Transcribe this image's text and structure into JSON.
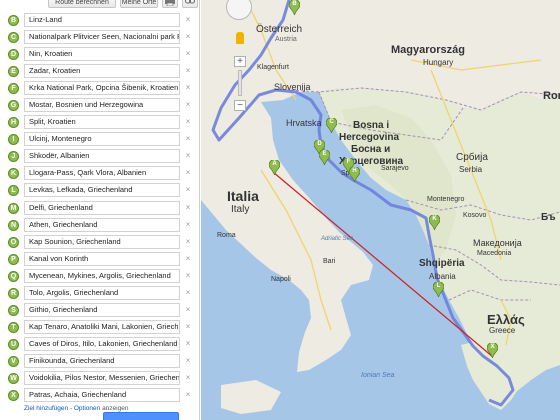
{
  "toolbar": {
    "route_button": "Route berechnen",
    "my_places_button": "Meine Orte"
  },
  "stops": [
    {
      "letter": "B",
      "value": "Linz-Land"
    },
    {
      "letter": "C",
      "value": "Nationalpark Plitvicer Seen, Nacionalni park P"
    },
    {
      "letter": "D",
      "value": "Nin, Kroatien"
    },
    {
      "letter": "E",
      "value": "Zadar, Kroatien"
    },
    {
      "letter": "F",
      "value": "Krka National Park, Opcina Šibenik, Kroatien"
    },
    {
      "letter": "G",
      "value": "Mostar, Bosnien und Herzegowina"
    },
    {
      "letter": "H",
      "value": "Split, Kroatien"
    },
    {
      "letter": "I",
      "value": "Ulcinj, Montenegro"
    },
    {
      "letter": "J",
      "value": "Shkodër, Albanien"
    },
    {
      "letter": "K",
      "value": "Llogara-Pass, Qark Vlora, Albanien"
    },
    {
      "letter": "L",
      "value": "Levkas, Lefkada, Griechenland"
    },
    {
      "letter": "M",
      "value": "Delfi, Griechenland"
    },
    {
      "letter": "N",
      "value": "Athen, Griechenland"
    },
    {
      "letter": "O",
      "value": "Kap Sounion, Griechenland"
    },
    {
      "letter": "P",
      "value": "Kanal von Korinth"
    },
    {
      "letter": "Q",
      "value": "Mycenean, Mykines, Argolis, Griechenland"
    },
    {
      "letter": "R",
      "value": "Tolo, Argolis, Griechenland"
    },
    {
      "letter": "S",
      "value": "Githio, Griechenland"
    },
    {
      "letter": "T",
      "value": "Kap Tenaro, Anatoliki Mani, Lakonien, Griech"
    },
    {
      "letter": "U",
      "value": "Caves of Diros, Itilo, Lakonien, Griechenland"
    },
    {
      "letter": "V",
      "value": "Finikounda, Griechenland"
    },
    {
      "letter": "W",
      "value": "Voidokilia, Pilos Nestor, Messenien, Griechen"
    },
    {
      "letter": "X",
      "value": "Patras, Achaia, Griechenland"
    }
  ],
  "footer": {
    "add_destination": "Ziel hinzufügen",
    "separator": " - ",
    "options": "Optionen",
    "show": " anzeigen"
  },
  "map": {
    "labels": {
      "austria_de": "Österreich",
      "austria_en": "Austria",
      "hungary_de": "Magyarország",
      "hungary_en": "Hungary",
      "romania": "Rom",
      "slovenia": "Slovenija",
      "croatia": "Hrvatska",
      "bosnia_latin": "Bosna i",
      "herzegovina_latin": "Hercegovina",
      "bosnia_cyr": "Босна и",
      "herzegovina_cyr": "Херцеговина",
      "serbia_cyr": "Србија",
      "serbia_en": "Serbia",
      "split": "Split",
      "sarajevo": "Sarajevo",
      "montenegro": "Montenegro",
      "kosovo": "Kosovo",
      "macedonia_cyr": "Македонија",
      "macedonia_en": "Macedonia",
      "bulgaria": "Бъ",
      "albania_local": "Shqipëria",
      "albania_en": "Albania",
      "italy_local": "Italia",
      "italy_en": "Italy",
      "greece_local": "Ελλάς",
      "greece_en": "Greece",
      "adriatic": "Adriatic Sea",
      "ionian": "Ionian Sea",
      "klagenfurt": "Klagenfurt",
      "roma": "Roma",
      "napoli": "Napoli",
      "bari": "Bari"
    },
    "route_color": "#5b6ed9",
    "line_color": "#cc2222",
    "marker_color": "#8fbd4d"
  },
  "markers": [
    "A",
    "B",
    "C",
    "D",
    "E",
    "F",
    "H",
    "K",
    "L",
    "X"
  ]
}
